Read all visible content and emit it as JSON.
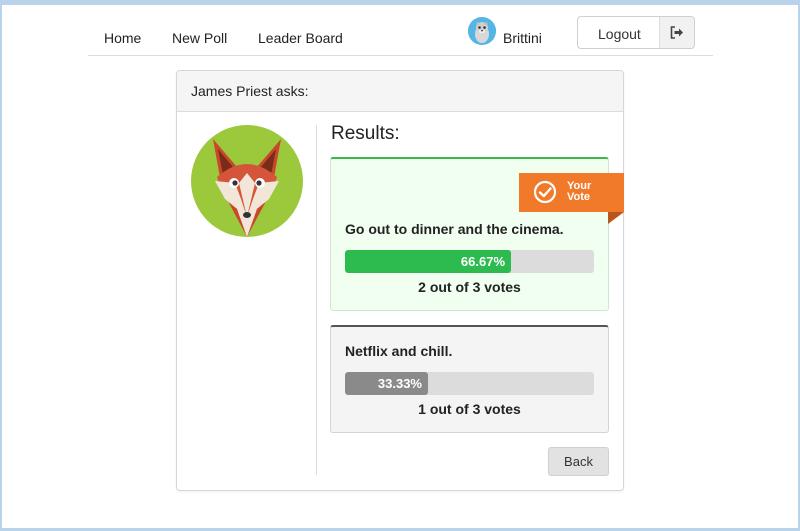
{
  "nav": {
    "links": [
      "Home",
      "New Poll",
      "Leader Board"
    ],
    "user_name": "Brittini",
    "logout_label": "Logout"
  },
  "poll": {
    "header": "James Priest asks:",
    "results_title": "Results:",
    "your_vote_badge": "Your Vote",
    "options": [
      {
        "text": "Go out to dinner and the cinema.",
        "percent_label": "66.67%",
        "percent": 66.67,
        "votes_label": "2 out of 3 votes",
        "voted": true
      },
      {
        "text": "Netflix and chill.",
        "percent_label": "33.33%",
        "percent": 33.33,
        "votes_label": "1 out of 3 votes",
        "voted": false
      }
    ],
    "back_label": "Back"
  },
  "colors": {
    "voted_green": "#2dba4e",
    "badge_orange": "#f07a2a",
    "other_gray": "#8a8a8a"
  }
}
